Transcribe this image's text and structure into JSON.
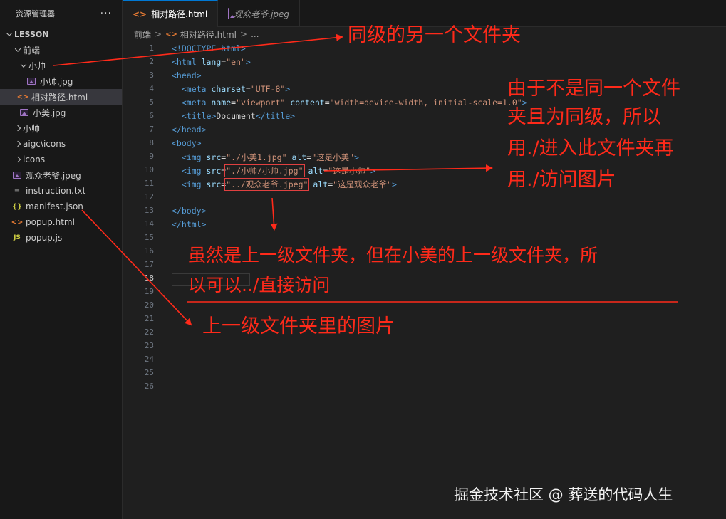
{
  "sidebar": {
    "title": "资源管理器",
    "more": "···",
    "root": "LESSON",
    "items": [
      {
        "label": "前端",
        "icon": "chevron-down"
      },
      {
        "label": "小帅",
        "icon": "chevron-down"
      },
      {
        "label": "小帅.jpg",
        "icon": "image-file"
      },
      {
        "label": "相对路径.html",
        "icon": "html-file"
      },
      {
        "label": "小美.jpg",
        "icon": "image-file"
      },
      {
        "label": "小帅",
        "icon": "chevron-right"
      },
      {
        "label": "aigc\\icons",
        "icon": "chevron-right"
      },
      {
        "label": "icons",
        "icon": "chevron-right"
      },
      {
        "label": "观众老爷.jpeg",
        "icon": "image-file"
      },
      {
        "label": "instruction.txt",
        "icon": "text-file"
      },
      {
        "label": "manifest.json",
        "icon": "json-file"
      },
      {
        "label": "popup.html",
        "icon": "html-file"
      },
      {
        "label": "popup.js",
        "icon": "js-file"
      }
    ]
  },
  "tabs": [
    {
      "label": "相对路径.html",
      "active": true
    },
    {
      "label": "观众老爷.jpeg",
      "active": false
    }
  ],
  "breadcrumb": [
    "前端",
    "相对路径.html",
    "..."
  ],
  "editor": {
    "current_line": 18,
    "line_numbers": [
      "1",
      "2",
      "3",
      "4",
      "5",
      "6",
      "7",
      "8",
      "9",
      "10",
      "11",
      "12",
      "13",
      "14",
      "15",
      "16",
      "17",
      "18",
      "19",
      "20",
      "21",
      "22",
      "23",
      "24",
      "25",
      "26"
    ],
    "code": {
      "l1_tag": "<!DOCTYPE html>",
      "l2_open": "<html",
      "l2_attr": "lang",
      "l2_eq": "=",
      "l2_str": "\"en\"",
      "l2_close": ">",
      "l3_tag": "<head>",
      "l4_open": "<meta",
      "l4_attr": "charset",
      "l4_eq": "=",
      "l4_str": "\"UTF-8\"",
      "l4_close": ">",
      "l5_open": "<meta",
      "l5_attr1": "name",
      "l5_eq1": "=",
      "l5_str1": "\"viewport\"",
      "l5_attr2": "content",
      "l5_eq2": "=",
      "l5_str2": "\"width=device-width, initial-scale=1.0\"",
      "l5_close": ">",
      "l6_open": "<title>",
      "l6_text": "Document",
      "l6_close": "</title>",
      "l7_tag": "</head>",
      "l8_tag": "<body>",
      "l9_open": "<img",
      "l9_attr1": "src",
      "l9_eq1": "=",
      "l9_str1": "\"./小美1.jpg\"",
      "l9_attr2": "alt",
      "l9_eq2": "=",
      "l9_str2": "\"这是小美\"",
      "l9_close": ">",
      "l10_open": "<img",
      "l10_attr1": "src",
      "l10_eq1": "=",
      "l10_str1": "\"./小帅/小帅.jpg\"",
      "l10_attr2": "alt",
      "l10_eq2": "=",
      "l10_str2": "\"这是小帅\"",
      "l10_close": ">",
      "l11_open": "<img",
      "l11_attr1": "src",
      "l11_eq1": "=",
      "l11_str1": "\"../观众老爷.jpeg\"",
      "l11_attr2": "alt",
      "l11_eq2": "=",
      "l11_str2": "\"这是观众老爷\"",
      "l11_close": ">",
      "l13_tag": "</body>",
      "l14_tag": "</html>"
    }
  },
  "annotations": {
    "a1": "同级的另一个文件夹",
    "a2_l1": "由于不是同一个文件",
    "a2_l2": "夹且为同级，所以",
    "a2_l3": "用./进入此文件夹再",
    "a2_l4": "用./访问图片",
    "a3_l1": "虽然是上一级文件夹，但在小美的上一级文件夹，所",
    "a3_l2": "以可以../直接访问",
    "a4": "上一级文件夹里的图片",
    "color": "#ff2a1a"
  },
  "watermark": "掘金技术社区 @ 葬送的代码人生"
}
